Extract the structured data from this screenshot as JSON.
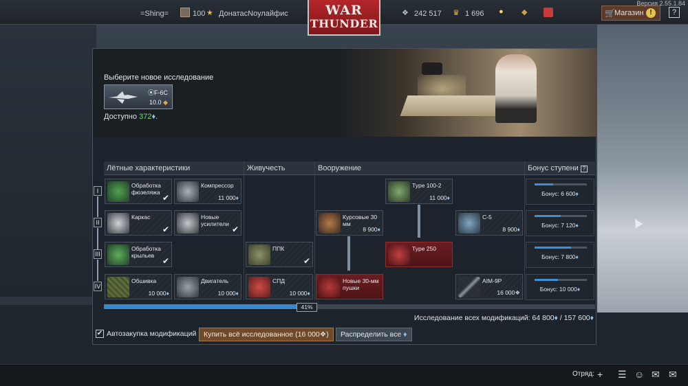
{
  "app": {
    "version": "Версия 2.55.1.84",
    "logo_line1": "WAR",
    "logo_line2": "THUNDER"
  },
  "topbar": {
    "nickname": "=Shing=",
    "level": "100",
    "squad_name": "ДонатасNоулайфис",
    "silver_lions": "242 517",
    "golden_eagles": "1 696",
    "shop_label": "Магазин",
    "help_icon": "question-icon"
  },
  "research": {
    "choose_title": "Выберите новое исследование",
    "vehicle_name": "F-6C",
    "vehicle_br": "10.0",
    "available_label": "Доступно",
    "available_value": "372"
  },
  "columns": {
    "flight": "Лётные характеристики",
    "survivability": "Живучесть",
    "armament": "Вооружение",
    "bonus": "Бонус ступени"
  },
  "tiers": [
    "I",
    "II",
    "III",
    "IV"
  ],
  "mods": {
    "fuselage": {
      "name": "Обработка фюзеляжа"
    },
    "compressor": {
      "name": "Компрессор",
      "cost": "11 000"
    },
    "frame": {
      "name": "Каркас"
    },
    "new_boosters": {
      "name": "Новые усилители"
    },
    "wings": {
      "name": "Обработка крыльев"
    },
    "cover": {
      "name": "Обшивка",
      "cost": "10 000"
    },
    "engine": {
      "name": "Двигатель",
      "cost": "10 000"
    },
    "ppk": {
      "name": "ППК"
    },
    "spd": {
      "name": "СПД",
      "cost": "10 000"
    },
    "type1002": {
      "name": "Type 100-2",
      "cost": "11 000"
    },
    "guns30": {
      "name": "Курсовые 30 мм",
      "cost": "8 900"
    },
    "c5": {
      "name": "С-5",
      "cost": "8 900"
    },
    "type250": {
      "name": "Type 250"
    },
    "new30": {
      "name": "Новые 30-мм пушки"
    },
    "aim9p": {
      "name": "AIM-9P",
      "cost": "16 000"
    }
  },
  "bonuses": [
    {
      "text": "Бонус: 6 600",
      "fill": 0.35
    },
    {
      "text": "Бонус: 7 120",
      "fill": 0.5
    },
    {
      "text": "Бонус: 7 800",
      "fill": 0.7
    },
    {
      "text": "Бонус: 10 000",
      "fill": 0.45
    }
  ],
  "progress": {
    "label": "41%",
    "fraction": 0.41
  },
  "total": {
    "label": "Исследование всех модификаций:",
    "value": "64 800",
    "separator": "/",
    "max": "157 600"
  },
  "actions": {
    "autobuy": "Автозакупка модификаций",
    "buy_all": "Купить всё исследованное (16 000",
    "distribute": "Распределить все"
  },
  "bottombar": {
    "squad": "Отряд:"
  }
}
